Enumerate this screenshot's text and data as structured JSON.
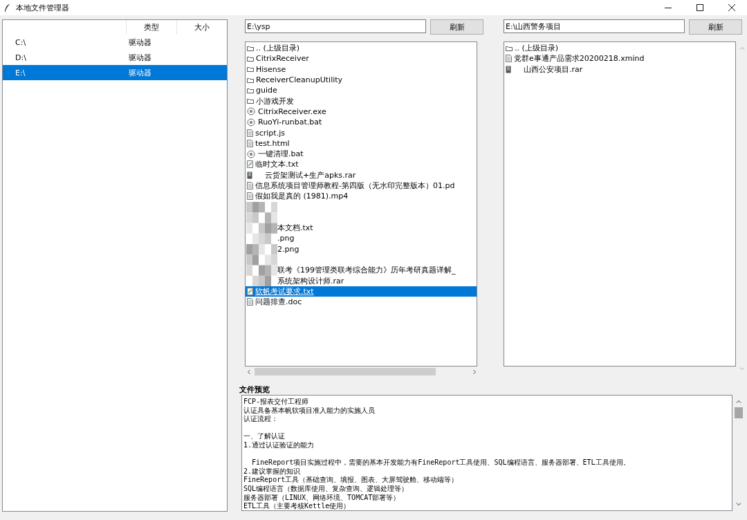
{
  "window": {
    "title": "本地文件管理器"
  },
  "drives": {
    "columns": [
      "类型",
      "大小"
    ],
    "rows": [
      {
        "name": "C:\\",
        "type": "驱动器",
        "selected": false
      },
      {
        "name": "D:\\",
        "type": "驱动器",
        "selected": false
      },
      {
        "name": "E:\\",
        "type": "驱动器",
        "selected": true
      }
    ]
  },
  "left_pane": {
    "path": "E:\\ysp",
    "button": "刷新",
    "items": [
      {
        "kind": "folder",
        "name": ".. (上级目录)",
        "selected": false
      },
      {
        "kind": "folder",
        "name": "CitrixReceiver",
        "selected": false
      },
      {
        "kind": "folder",
        "name": "Hisense",
        "selected": false
      },
      {
        "kind": "folder",
        "name": "ReceiverCleanupUtility",
        "selected": false
      },
      {
        "kind": "folder",
        "name": "guide",
        "selected": false
      },
      {
        "kind": "folder",
        "name": "小游戏开发",
        "selected": false
      },
      {
        "kind": "program",
        "name": "CitrixReceiver.exe",
        "selected": false
      },
      {
        "kind": "program",
        "name": "RuoYi-runbat.bat",
        "selected": false
      },
      {
        "kind": "file",
        "name": "script.js",
        "selected": false
      },
      {
        "kind": "file",
        "name": "test.html",
        "selected": false
      },
      {
        "kind": "program",
        "name": "一键清理.bat",
        "selected": false
      },
      {
        "kind": "text",
        "name": "临时文本.txt",
        "selected": false
      },
      {
        "kind": "archive",
        "name": "云货架测试+生产apks.rar",
        "selected": false
      },
      {
        "kind": "file",
        "name": "信息系统项目管理师教程-第四版（无水印完整版本）01.pd",
        "selected": false
      },
      {
        "kind": "file",
        "name": "假如我是真的 (1981).mp4",
        "selected": false
      },
      {
        "kind": "obscured",
        "selected": false
      },
      {
        "kind": "obscured",
        "selected": false
      },
      {
        "kind": "obscured",
        "name": "本文档.txt",
        "selected": false
      },
      {
        "kind": "obscured",
        "name": ".png",
        "selected": false
      },
      {
        "kind": "obscured",
        "name": "2.png",
        "selected": false
      },
      {
        "kind": "obscured",
        "selected": false
      },
      {
        "kind": "obscured",
        "name": "联考《199管理类联考综合能力》历年考研真题详解_",
        "selected": false
      },
      {
        "kind": "obscured",
        "name": "系统架构设计师.rar",
        "selected": false
      },
      {
        "kind": "text",
        "name": "软帆考试要求.txt",
        "selected": true
      },
      {
        "kind": "file",
        "name": "问题排查.doc",
        "selected": false
      }
    ]
  },
  "right_pane": {
    "path": "E:\\山西警务项目",
    "button": "刷新",
    "items": [
      {
        "kind": "folder",
        "name": ".. (上级目录)",
        "selected": false
      },
      {
        "kind": "file",
        "name": "党群e事通产品需求20200218.xmind",
        "selected": false
      },
      {
        "kind": "archive",
        "name": "山西公安项目.rar",
        "selected": false
      }
    ]
  },
  "preview": {
    "label": "文件预览",
    "lines": [
      {
        "text": "FCP-报表交付工程师",
        "blank_before": false
      },
      {
        "text": "认证具备基本帆软项目准入能力的实施人员",
        "blank_before": false
      },
      {
        "text": "认证流程：",
        "blank_before": false
      },
      {
        "text": "一、了解认证",
        "blank_before": true
      },
      {
        "text": "1.通过认证验证的能力",
        "blank_before": false
      },
      {
        "text": "  FineReport项目实施过程中，需要的基本开发能力有FineReport工具使用、SQL编程语言、服务器部署、ETL工具使用。",
        "blank_before": true
      },
      {
        "text": "2.建议掌握的知识",
        "blank_before": false
      },
      {
        "text": "FineReport工具（基础查询、填报、图表、大屏驾驶舱、移动端等）",
        "blank_before": false
      },
      {
        "text": "SQL编程语言（数据库使用、复杂查询、逻辑处理等）",
        "blank_before": false
      },
      {
        "text": "服务器部署（LINUX、网络环境、TOMCAT部署等）",
        "blank_before": false
      },
      {
        "text": "ETL工具（主要考核Kettle使用）",
        "blank_before": false
      }
    ]
  }
}
